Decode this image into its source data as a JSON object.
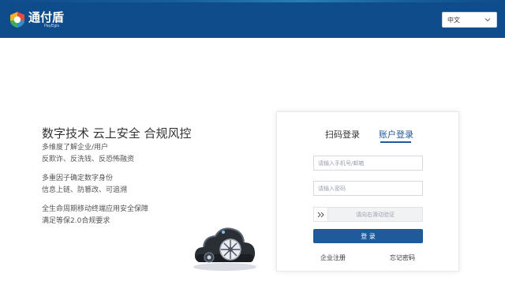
{
  "header": {
    "logo_text": "通付盾",
    "logo_sub": "PayEgis",
    "language_selected": "中文",
    "colors": {
      "bar": "#0f4c8c",
      "accent": "#1f5a9a"
    }
  },
  "intro": {
    "headline": "数字技术 云上安全 合规风控",
    "paragraphs": [
      {
        "line1": "多维度了解企业/用户",
        "line2": "反欺诈、反洗钱、反恐怖融资"
      },
      {
        "line1": "多重因子确定数字身份",
        "line2": "信息上链、防篡改、可追溯"
      },
      {
        "line1": "全生命周期移动终端应用安全保障",
        "line2": "满足等保2.0合规要求"
      }
    ]
  },
  "login": {
    "tabs": {
      "qr": "扫码登录",
      "account": "账户登录"
    },
    "active_tab": "account",
    "phone_placeholder": "请输入手机号/邮箱",
    "password_placeholder": "请输入密码",
    "slider_text": "请向右滑动验证",
    "submit_label": "登 录",
    "register_link": "企业注册",
    "forgot_link": "忘记密码"
  },
  "icons": [
    "logo-mark-icon",
    "chevron-down-icon",
    "double-chevron-right-icon",
    "cloud-lock-icon"
  ]
}
